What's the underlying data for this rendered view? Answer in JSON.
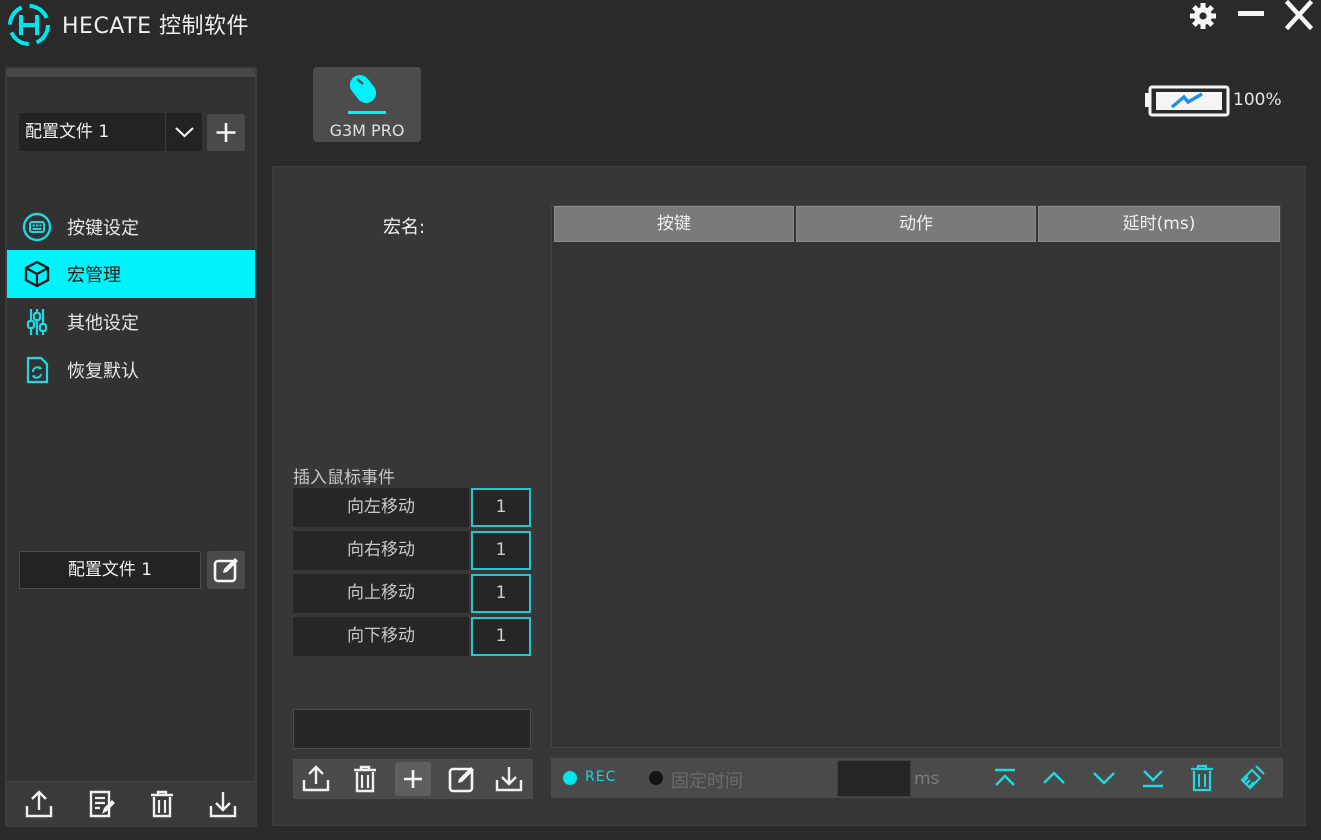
{
  "window": {
    "title": "HECATE 控制软件",
    "icons": [
      "hecate-logo",
      "gear-icon",
      "minimize-icon",
      "close-icon"
    ]
  },
  "sidebar": {
    "profile_select_value": "配置文件 1",
    "nav": [
      {
        "label": "按键设定",
        "icon": "keyboard-icon",
        "active": false
      },
      {
        "label": "宏管理",
        "icon": "macro-cube-icon",
        "active": true
      },
      {
        "label": "其他设定",
        "icon": "sliders-icon",
        "active": false
      },
      {
        "label": "恢复默认",
        "icon": "restore-icon",
        "active": false
      }
    ],
    "profile_name": "配置文件 1",
    "actions": [
      "export-icon",
      "notes-icon",
      "trash-icon",
      "import-icon"
    ]
  },
  "device": {
    "name": "G3M PRO",
    "battery": "100%"
  },
  "macro": {
    "name_label": "宏名:",
    "insert_title": "插入鼠标事件",
    "moves": [
      {
        "label": "向左移动",
        "value": "1"
      },
      {
        "label": "向右移动",
        "value": "1"
      },
      {
        "label": "向上移动",
        "value": "1"
      },
      {
        "label": "向下移动",
        "value": "1"
      }
    ],
    "table_headers": [
      "按键",
      "动作",
      "延时(ms)"
    ],
    "rec_label": "REC",
    "fixed_time_label": "固定时间",
    "delay_unit": "ms"
  },
  "colors": {
    "accent": "#00f2fa",
    "background": "#2a2a2a",
    "panel": "#373737"
  }
}
